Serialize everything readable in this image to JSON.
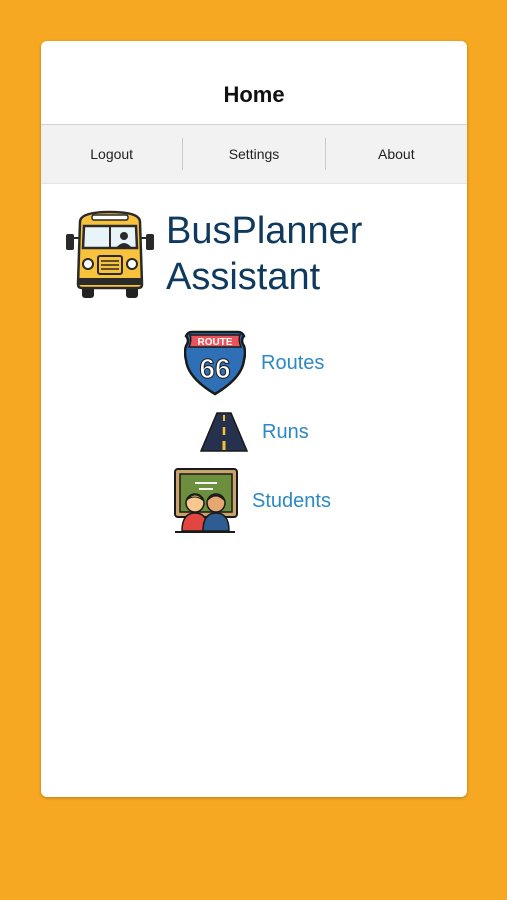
{
  "header": {
    "title": "Home"
  },
  "nav": {
    "logout_label": "Logout",
    "settings_label": "Settings",
    "about_label": "About"
  },
  "brand": {
    "line1": "BusPlanner",
    "line2": "Assistant",
    "logo_icon": "school-bus-icon"
  },
  "menu": [
    {
      "label": "Routes",
      "icon": "route-66-shield-icon"
    },
    {
      "label": "Runs",
      "icon": "road-icon"
    },
    {
      "label": "Students",
      "icon": "students-chalkboard-icon"
    }
  ],
  "icon_texts": {
    "route_shield": "ROUTE",
    "route_number": "66"
  },
  "colors": {
    "background": "#F7A823",
    "brand_text": "#0f3a5e",
    "link_text": "#2b8ac4",
    "card": "#ffffff"
  }
}
